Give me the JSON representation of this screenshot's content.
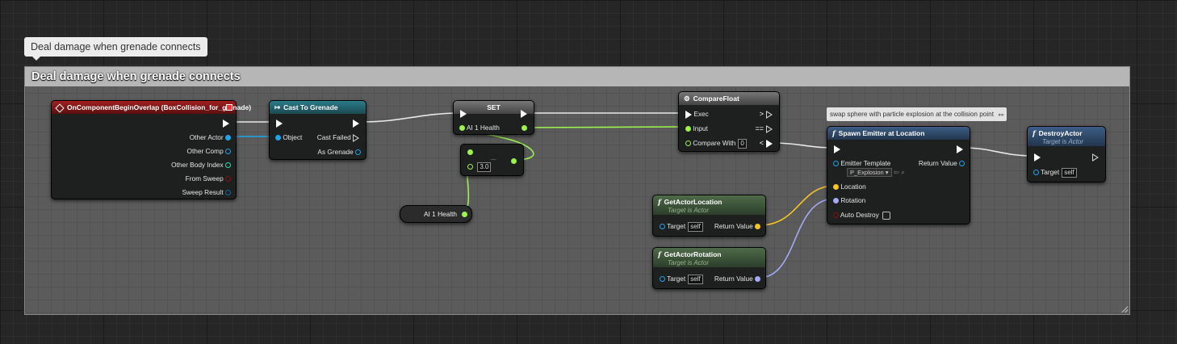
{
  "comment": {
    "bubble_text": "Deal damage when grenade connects",
    "title": "Deal damage when grenade connects"
  },
  "nodes": {
    "event": {
      "title": "OnComponentBeginOverlap (BoxCollision_for_grenade)",
      "pins": [
        "Other Actor",
        "Other Comp",
        "Other Body Index",
        "From Sweep",
        "Sweep Result"
      ]
    },
    "cast": {
      "title": "Cast To Grenade",
      "object_pin": "Object",
      "cast_failed": "Cast Failed",
      "as_grenade": "As Grenade"
    },
    "set": {
      "title": "SET",
      "var_pin": "AI 1 Health"
    },
    "subtract": {
      "value": "3.0"
    },
    "get_health": {
      "label": "AI 1 Health"
    },
    "compare": {
      "title": "CompareFloat",
      "exec": "Exec",
      "input": "Input",
      "compare_with": "Compare With",
      "compare_with_value": "0",
      "gt": ">",
      "eq": "==",
      "lt": "<"
    },
    "get_location": {
      "title": "GetActorLocation",
      "subtitle": "Target is Actor",
      "target": "Target",
      "target_value": "self",
      "return_value": "Return Value"
    },
    "get_rotation": {
      "title": "GetActorRotation",
      "subtitle": "Target is Actor",
      "target": "Target",
      "target_value": "self",
      "return_value": "Return Value"
    },
    "spawn": {
      "comment": "swap sphere with particle explosion at the collision point",
      "title": "Spawn Emitter at Location",
      "emitter_template": "Emitter Template",
      "emitter_value": "P_Explosion",
      "return_value": "Return Value",
      "location": "Location",
      "rotation": "Rotation",
      "auto_destroy": "Auto Destroy"
    },
    "destroy": {
      "title": "DestroyActor",
      "subtitle": "Target is Actor",
      "target": "Target",
      "target_value": "self"
    }
  },
  "colors": {
    "object_pin": "#1ea4e9",
    "float_pin": "#9cf24e",
    "vector_pin": "#f5c424",
    "rotator_pin": "#a3a9f9",
    "struct_pin": "#0b6aa8",
    "int_pin": "#2ee0ae",
    "bool_pin": "#8c0f0f",
    "exec_wire": "#ffffff"
  }
}
